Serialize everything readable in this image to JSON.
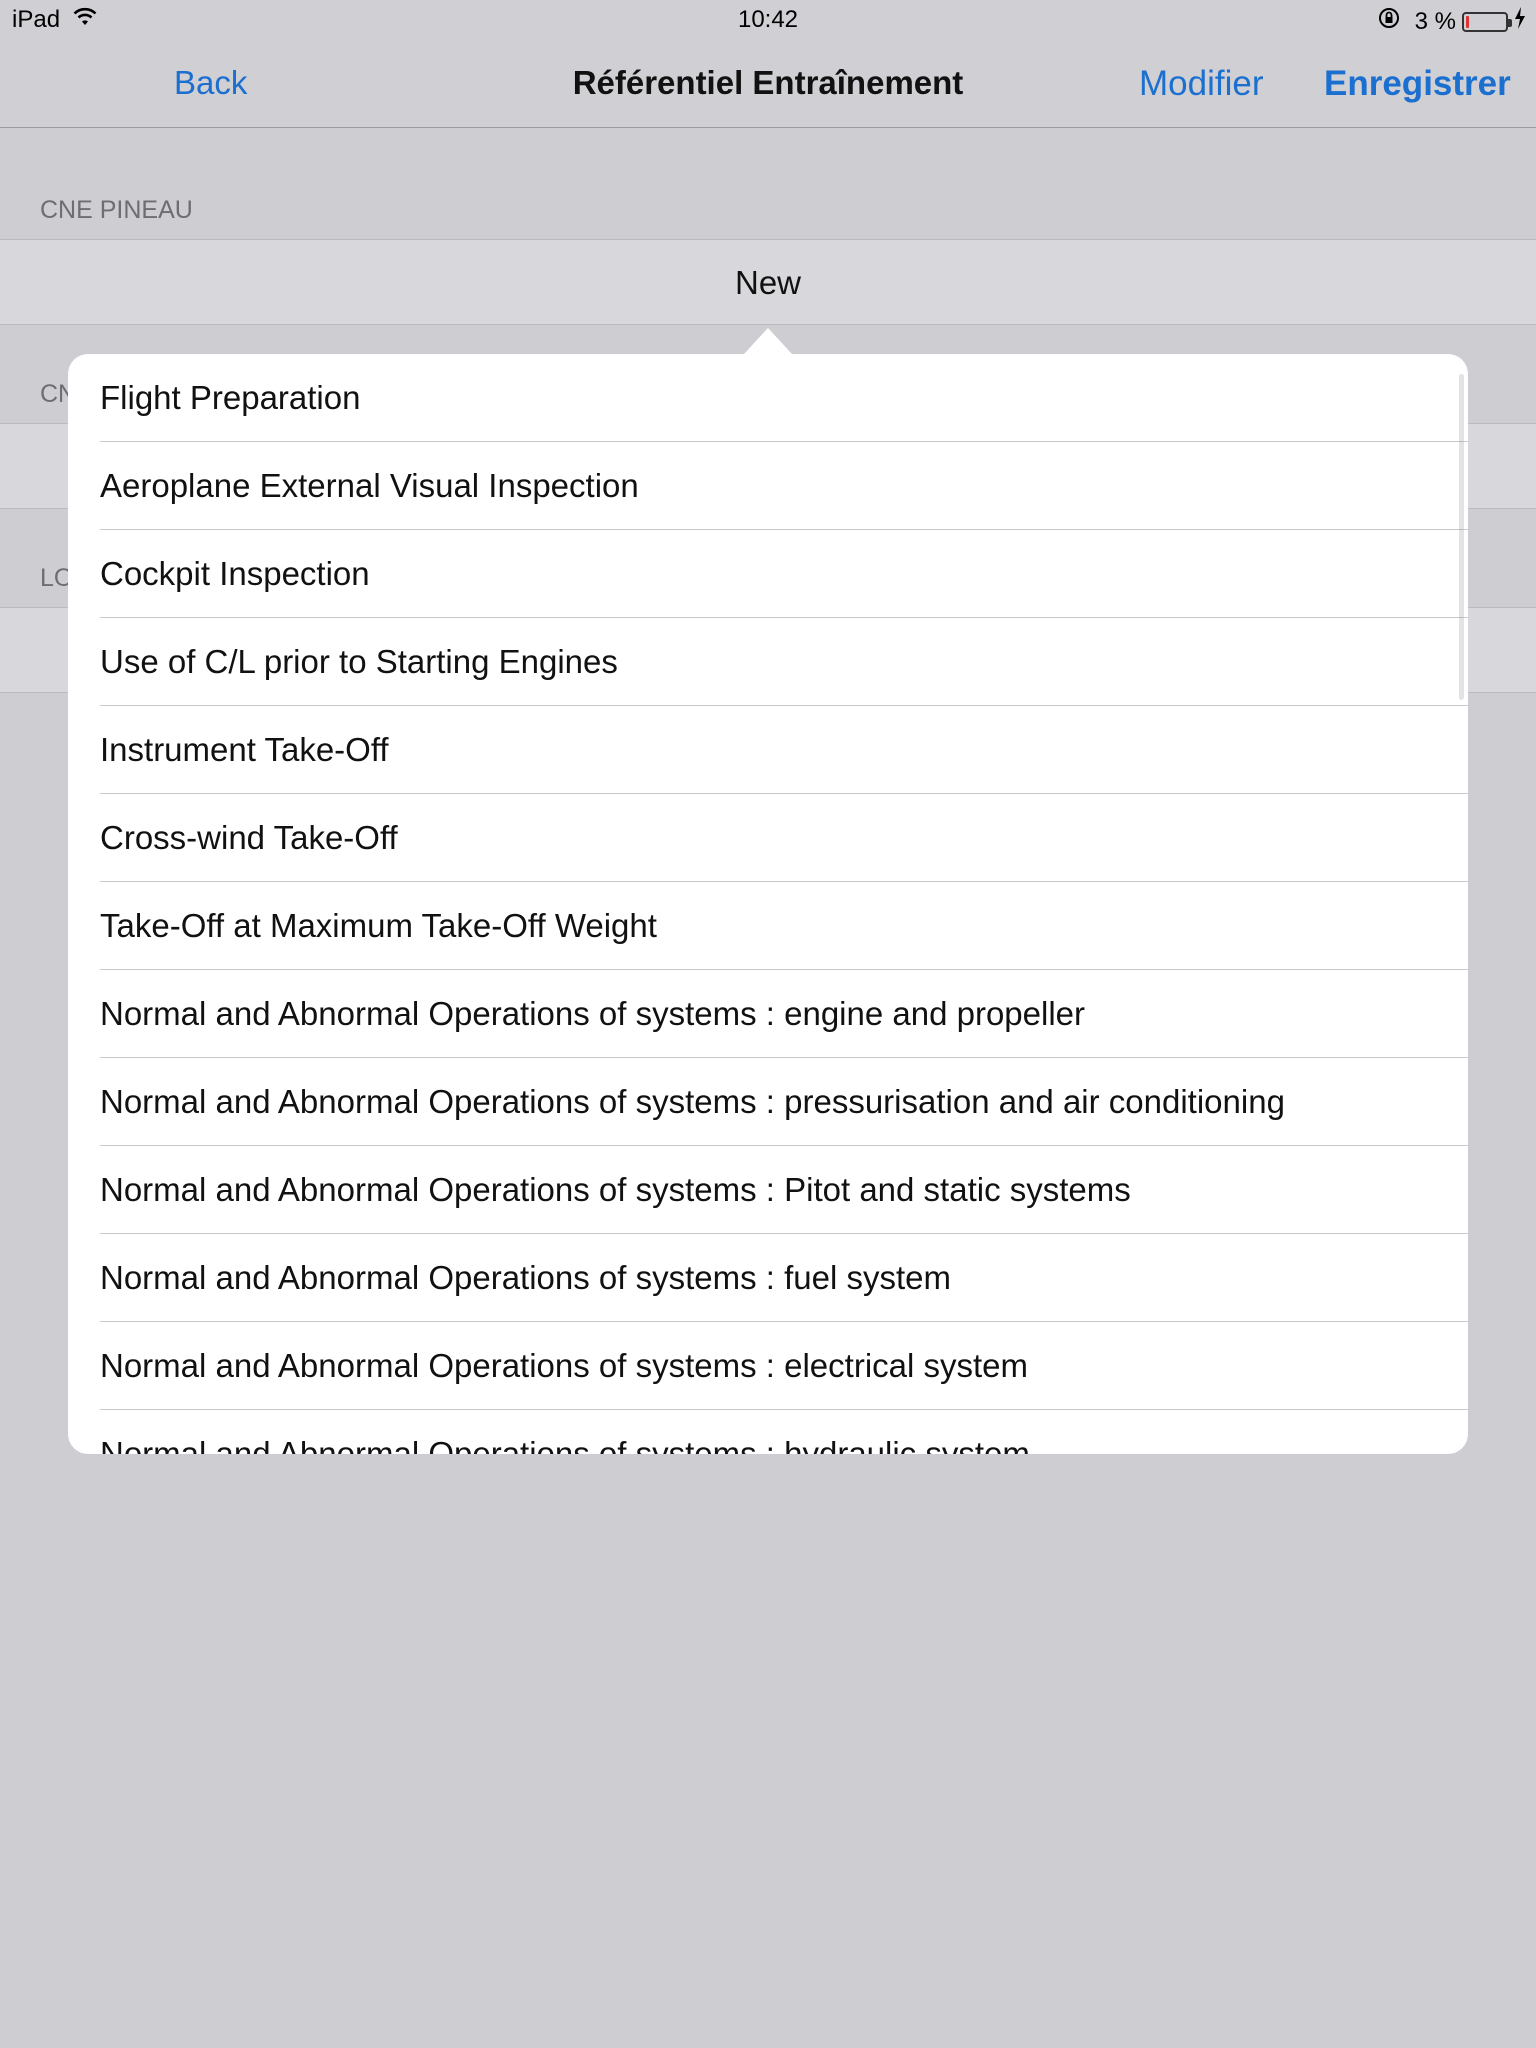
{
  "status_bar": {
    "carrier": "iPad",
    "time": "10:42",
    "battery_percent": "3 %"
  },
  "nav": {
    "back": "Back",
    "title": "Référentiel Entraînement",
    "modifier": "Modifier",
    "save": "Enregistrer"
  },
  "sections": [
    {
      "header": "CNE PINEAU",
      "cell": "New"
    },
    {
      "header": "CN"
    },
    {
      "header": "LO"
    }
  ],
  "popover": {
    "items": [
      "Flight Preparation",
      "Aeroplane External Visual Inspection",
      "Cockpit Inspection",
      "Use of C/L prior to Starting Engines",
      "Instrument Take-Off",
      "Cross-wind Take-Off",
      "Take-Off at Maximum Take-Off Weight",
      "Normal and Abnormal Operations of systems : engine and propeller",
      "Normal and Abnormal Operations of systems : pressurisation and air conditioning",
      "Normal and Abnormal Operations of systems : Pitot and static systems",
      "Normal and Abnormal Operations of systems : fuel system",
      "Normal and Abnormal Operations of systems : electrical system",
      "Normal and Abnormal Operations of systems : hydraulic system"
    ]
  },
  "colors": {
    "accent": "#1b6fcf",
    "background": "#cdcdd2",
    "battery_low": "#dd3333"
  }
}
